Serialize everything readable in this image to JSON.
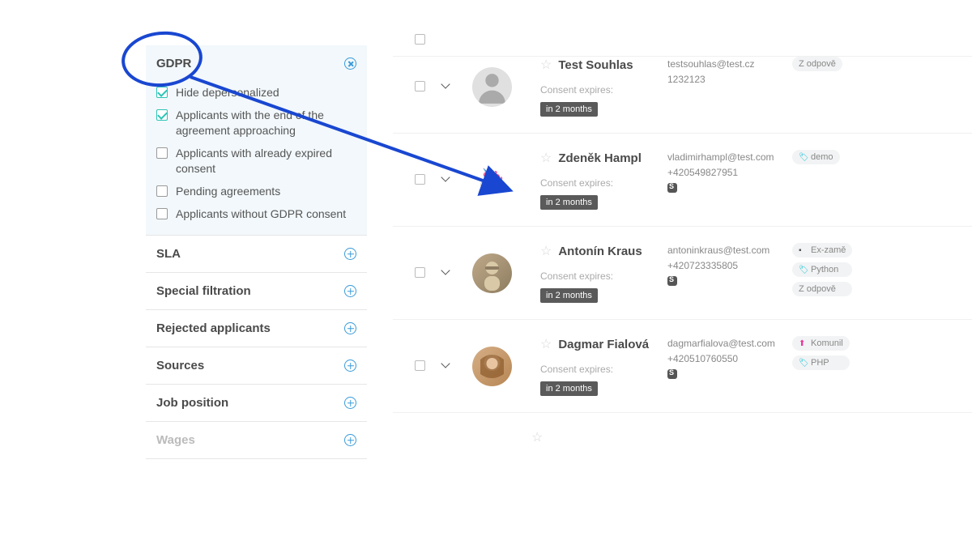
{
  "sidebar": {
    "gdpr": {
      "title": "GDPR",
      "options": [
        {
          "label": "Hide depersonalized",
          "checked": true
        },
        {
          "label": "Applicants with the end of the agreement approaching",
          "checked": true
        },
        {
          "label": "Applicants with already expired consent",
          "checked": false
        },
        {
          "label": "Pending agreements",
          "checked": false
        },
        {
          "label": "Applicants without GDPR consent",
          "checked": false
        }
      ]
    },
    "sections": [
      {
        "title": "SLA"
      },
      {
        "title": "Special filtration"
      },
      {
        "title": "Rejected applicants"
      },
      {
        "title": "Sources"
      },
      {
        "title": "Job position"
      },
      {
        "title": "Wages"
      }
    ]
  },
  "consent_label": "Consent expires:",
  "applicants": [
    {
      "name": "Test Souhlas",
      "consent_badge": "in 2 months",
      "email": "testsouhlas@test.cz",
      "phone": "1232123",
      "has_skype": false,
      "avatar": "placeholder",
      "tags": [
        {
          "label": "Z odpově",
          "variant": "plain"
        }
      ]
    },
    {
      "name": "Zdeněk Hampl",
      "consent_badge": "in 2 months",
      "email": "vladimirhampl@test.com",
      "phone": "+420549827951",
      "has_skype": true,
      "avatar": "pink",
      "tags": [
        {
          "label": "demo",
          "variant": "teal"
        }
      ]
    },
    {
      "name": "Antonín Kraus",
      "consent_badge": "in 2 months",
      "email": "antoninkraus@test.com",
      "phone": "+420723335805",
      "has_skype": true,
      "avatar": "photo1",
      "tags": [
        {
          "label": "Ex-zamě",
          "variant": "dark"
        },
        {
          "label": "Python",
          "variant": "teal"
        },
        {
          "label": "Z odpově",
          "variant": "plain"
        }
      ]
    },
    {
      "name": "Dagmar Fialová",
      "consent_badge": "in 2 months",
      "email": "dagmarfialova@test.com",
      "phone": "+420510760550",
      "has_skype": true,
      "avatar": "photo2",
      "tags": [
        {
          "label": "Komunil",
          "variant": "pink"
        },
        {
          "label": "PHP",
          "variant": "teal"
        }
      ]
    }
  ]
}
